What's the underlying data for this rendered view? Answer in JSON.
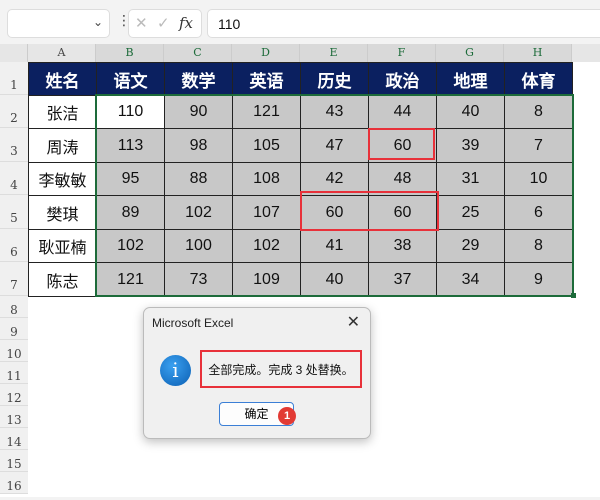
{
  "formula_bar": {
    "name_box": "",
    "formula": "110",
    "cancel_icon": "✕",
    "enter_icon": "✓",
    "fx": "fx"
  },
  "columns": [
    "A",
    "B",
    "C",
    "D",
    "E",
    "F",
    "G",
    "H"
  ],
  "rows": [
    "1",
    "2",
    "3",
    "4",
    "5",
    "6",
    "7",
    "8",
    "9",
    "10",
    "11",
    "12",
    "13",
    "14",
    "15",
    "16"
  ],
  "table": {
    "headers": [
      "姓名",
      "语文",
      "数学",
      "英语",
      "历史",
      "政治",
      "地理",
      "体育"
    ],
    "rows": [
      [
        "张洁",
        "110",
        "90",
        "121",
        "43",
        "44",
        "40",
        "8"
      ],
      [
        "周涛",
        "113",
        "98",
        "105",
        "47",
        "60",
        "39",
        "7"
      ],
      [
        "李敏敏",
        "95",
        "88",
        "108",
        "42",
        "48",
        "31",
        "10"
      ],
      [
        "樊琪",
        "89",
        "102",
        "107",
        "60",
        "60",
        "25",
        "6"
      ],
      [
        "耿亚楠",
        "102",
        "100",
        "102",
        "41",
        "38",
        "29",
        "8"
      ],
      [
        "陈志",
        "121",
        "73",
        "109",
        "40",
        "37",
        "34",
        "9"
      ]
    ]
  },
  "dialog": {
    "title": "Microsoft Excel",
    "message": "全部完成。完成 3 处替换。",
    "ok": "确定",
    "badge": "1"
  }
}
